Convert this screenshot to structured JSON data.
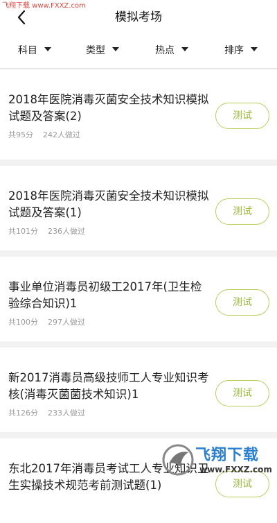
{
  "watermark": {
    "top_text": "飞翔下载 www.FXXZ.com",
    "bottom_brand": "飞翔下载",
    "bottom_url": "www.FXXZ.com"
  },
  "header": {
    "title": "模拟考场",
    "back_icon": "chevron-left-icon"
  },
  "filters": [
    {
      "label": "科目",
      "icon": "triangle-down-icon"
    },
    {
      "label": "类型",
      "icon": "triangle-down-icon"
    },
    {
      "label": "热点",
      "icon": "triangle-down-icon"
    },
    {
      "label": "排序",
      "icon": "triangle-down-icon"
    }
  ],
  "exams": [
    {
      "title": "2018年医院消毒灭菌安全技术知识模拟试题及答案(2)",
      "score": "共95分",
      "count": "242人做过",
      "button": "测试"
    },
    {
      "title": "2018年医院消毒灭菌安全技术知识模拟试题及答案(1)",
      "score": "共101分",
      "count": "236人做过",
      "button": "测试"
    },
    {
      "title": "事业单位消毒员初级工2017年(卫生检验综合知识)1",
      "score": "共100分",
      "count": "297人做过",
      "button": "测试"
    },
    {
      "title": "新2017消毒员高级技师工人专业知识考核(消毒灭菌菌技术知识)1",
      "score": "共126分",
      "count": "233人做过",
      "button": "测试"
    },
    {
      "title": "东北2017年消毒员考试工人专业知识卫生实操技术规范考前测试题(1)",
      "score": "",
      "count": "",
      "button": "测试"
    }
  ],
  "colors": {
    "accent": "#9ab83a",
    "accent_border": "#b7cf5f",
    "background": "#f2f2f2",
    "meta_text": "#9a9a9a"
  }
}
